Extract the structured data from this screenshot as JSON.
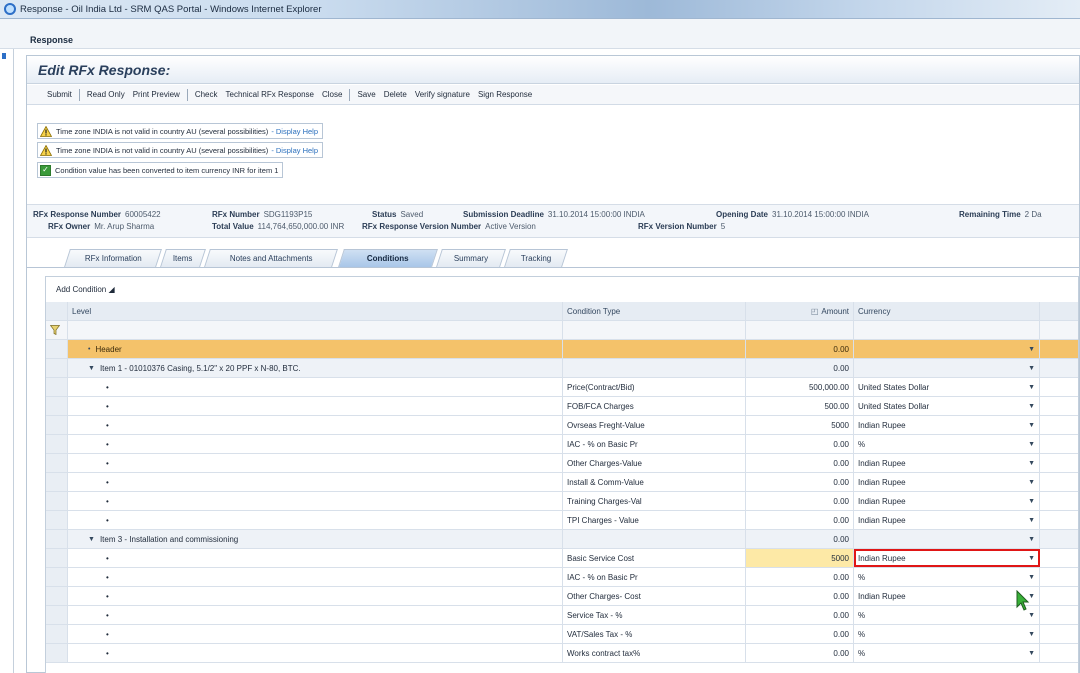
{
  "window": {
    "title": "Response - Oil India Ltd - SRM QAS Portal - Windows Internet Explorer"
  },
  "app": {
    "label": "Response"
  },
  "page": {
    "title": "Edit RFx Response:"
  },
  "toolbar": {
    "submit": "Submit",
    "read_only": "Read Only",
    "print_preview": "Print Preview",
    "check": "Check",
    "technical": "Technical RFx Response",
    "close": "Close",
    "save": "Save",
    "delete": "Delete",
    "verify": "Verify signature",
    "sign": "Sign Response"
  },
  "messages": [
    {
      "text": "Time zone INDIA is not valid in country AU (several possibilities)",
      "link": "- Display Help"
    },
    {
      "text": "Time zone INDIA is not valid in country AU (several possibilities)",
      "link": "- Display Help"
    },
    {
      "text": "Condition value has been converted to item currency INR for item 1"
    }
  ],
  "info": {
    "rfx_response_number_label": "RFx Response Number",
    "rfx_response_number": "60005422",
    "rfx_number_label": "RFx Number",
    "rfx_number": "SDG1193P15",
    "status_label": "Status",
    "status": "Saved",
    "submission_deadline_label": "Submission Deadline",
    "submission_deadline": "31.10.2014 15:00:00 INDIA",
    "opening_date_label": "Opening Date",
    "opening_date": "31.10.2014 15:00:00 INDIA",
    "remaining_time_label": "Remaining Time",
    "remaining_time": "2 Da",
    "rfx_owner_label": "RFx Owner",
    "rfx_owner": "Mr. Arup Sharma",
    "total_value_label": "Total Value",
    "total_value": "114,764,650,000.00 INR",
    "rfx_response_version_label": "RFx Response Version Number",
    "rfx_response_version": "Active Version",
    "rfx_version_label": "RFx Version Number",
    "rfx_version": "5"
  },
  "tabs": [
    "RFx Information",
    "Items",
    "Notes and Attachments",
    "Conditions",
    "Summary",
    "Tracking"
  ],
  "active_tab": "Conditions",
  "panel": {
    "add_condition": "Add Condition"
  },
  "grid": {
    "columns": {
      "level": "Level",
      "condition_type": "Condition Type",
      "amount": "Amount",
      "currency": "Currency"
    },
    "rows": [
      {
        "kind": "header-lvl",
        "level": "Header",
        "type": "",
        "amount": "0.00",
        "currency": ""
      },
      {
        "kind": "item",
        "level": "Item 1 - 01010376 Casing, 5.1/2\" x 20 PPF x N-80, BTC.",
        "type": "",
        "amount": "0.00",
        "currency": ""
      },
      {
        "kind": "cond",
        "level": "•",
        "type": "Price(Contract/Bid)",
        "amount": "500,000.00",
        "currency": "United States Dollar"
      },
      {
        "kind": "cond",
        "level": "•",
        "type": "FOB/FCA Charges",
        "amount": "500.00",
        "currency": "United States Dollar"
      },
      {
        "kind": "cond",
        "level": "•",
        "type": "Ovrseas Freght-Value",
        "amount": "5000",
        "currency": "Indian Rupee"
      },
      {
        "kind": "cond",
        "level": "•",
        "type": "IAC - % on Basic Pr",
        "amount": "0.00",
        "currency": "%"
      },
      {
        "kind": "cond",
        "level": "•",
        "type": "Other Charges-Value",
        "amount": "0.00",
        "currency": "Indian Rupee"
      },
      {
        "kind": "cond",
        "level": "•",
        "type": "Install & Comm-Value",
        "amount": "0.00",
        "currency": "Indian Rupee"
      },
      {
        "kind": "cond",
        "level": "•",
        "type": "Training Charges-Val",
        "amount": "0.00",
        "currency": "Indian Rupee"
      },
      {
        "kind": "cond",
        "level": "•",
        "type": "TPI Charges - Value",
        "amount": "0.00",
        "currency": "Indian Rupee"
      },
      {
        "kind": "item",
        "level": "Item 3 - Installation and commissioning",
        "type": "",
        "amount": "0.00",
        "currency": ""
      },
      {
        "kind": "cond",
        "level": "•",
        "type": "Basic Service Cost",
        "amount": "5000",
        "currency": "Indian Rupee",
        "editing": true
      },
      {
        "kind": "cond",
        "level": "•",
        "type": "IAC - % on Basic Pr",
        "amount": "0.00",
        "currency": "%"
      },
      {
        "kind": "cond",
        "level": "•",
        "type": "Other Charges- Cost",
        "amount": "0.00",
        "currency": "Indian Rupee"
      },
      {
        "kind": "cond",
        "level": "•",
        "type": "Service Tax - %",
        "amount": "0.00",
        "currency": "%"
      },
      {
        "kind": "cond",
        "level": "•",
        "type": "VAT/Sales Tax - %",
        "amount": "0.00",
        "currency": "%"
      },
      {
        "kind": "cond",
        "level": "•",
        "type": "Works contract tax%",
        "amount": "0.00",
        "currency": "%"
      }
    ]
  },
  "colors": {
    "header_row": "#f4c26a",
    "edit_amount": "#fde9a6",
    "edit_outline": "#e01616",
    "active_tab": "#a8c6e8"
  }
}
